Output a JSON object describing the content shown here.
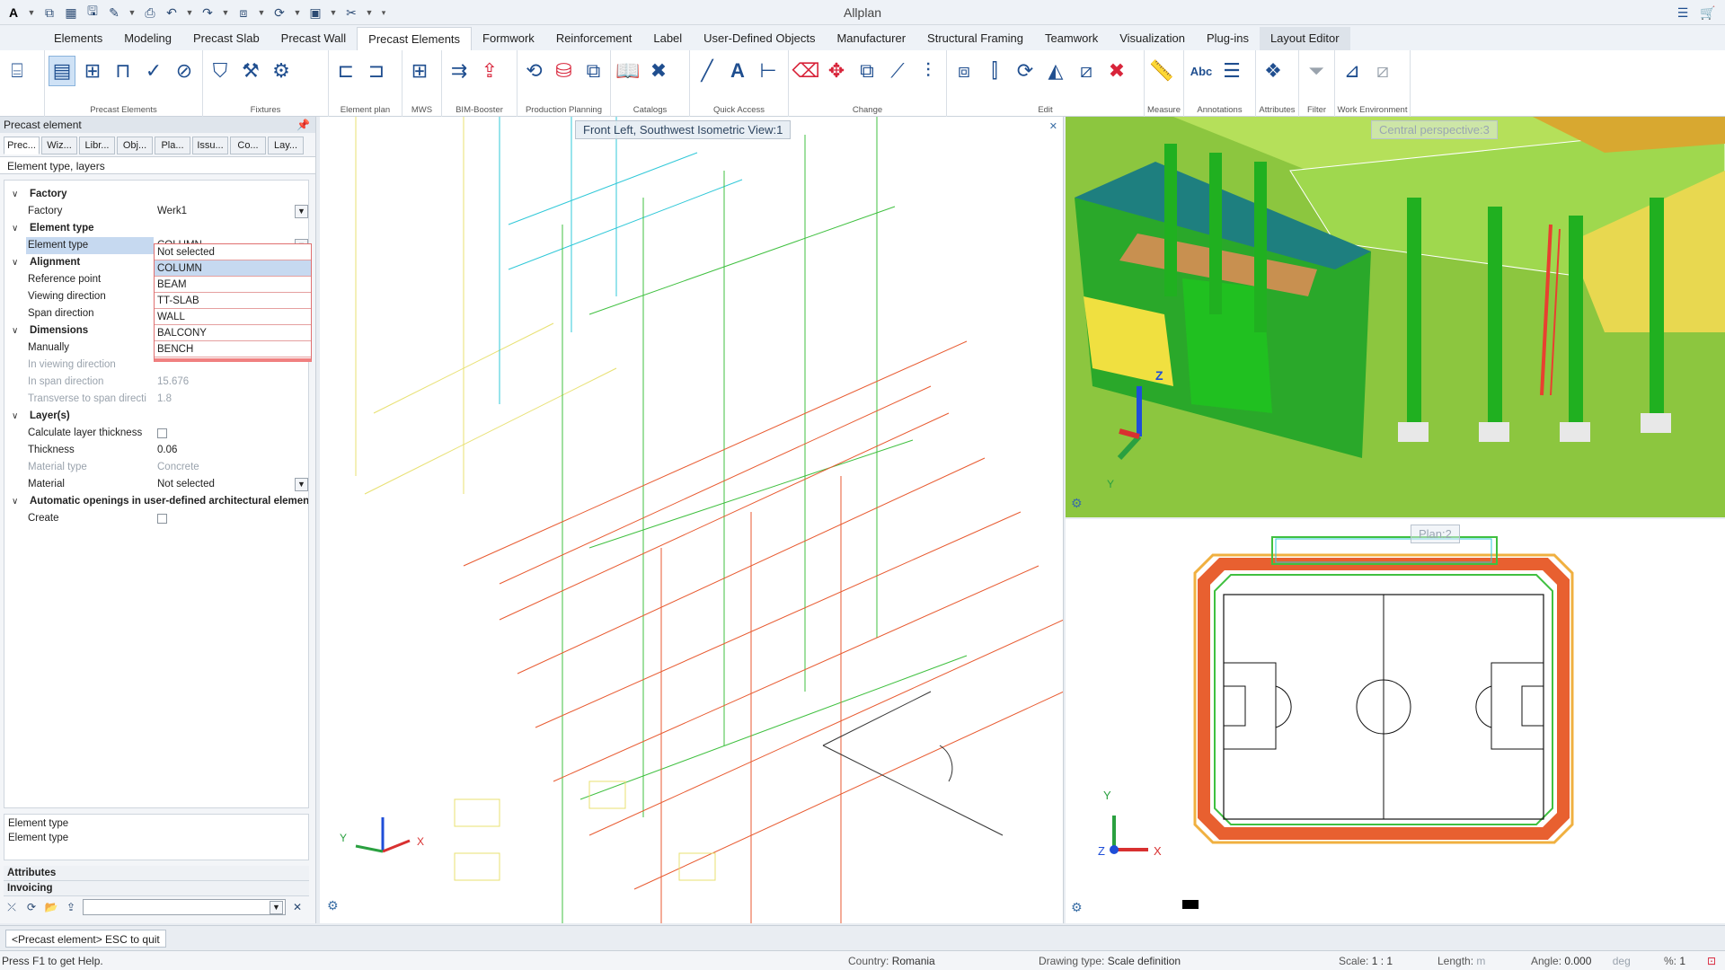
{
  "title_bar": {
    "app_title": "Allplan"
  },
  "ribbon_tabs": [
    {
      "label": "Elements"
    },
    {
      "label": "Modeling"
    },
    {
      "label": "Precast Slab"
    },
    {
      "label": "Precast Wall"
    },
    {
      "label": "Precast Elements"
    },
    {
      "label": "Formwork"
    },
    {
      "label": "Reinforcement"
    },
    {
      "label": "Label"
    },
    {
      "label": "User-Defined Objects"
    },
    {
      "label": "Manufacturer"
    },
    {
      "label": "Structural Framing"
    },
    {
      "label": "Teamwork"
    },
    {
      "label": "Visualization"
    },
    {
      "label": "Plug-ins"
    },
    {
      "label": "Layout Editor"
    }
  ],
  "ribbon_groups": {
    "precast_elements": "Precast Elements",
    "fixtures": "Fixtures",
    "element_plan": "Element plan",
    "mws": "MWS",
    "bim_booster": "BIM-Booster",
    "production_planning": "Production Planning",
    "catalogs": "Catalogs",
    "quick_access": "Quick Access",
    "change": "Change",
    "edit": "Edit",
    "measure": "Measure",
    "annotations": "Annotations",
    "attributes": "Attributes",
    "filter": "Filter",
    "work_environment": "Work Environment"
  },
  "left_panel": {
    "title": "Precast element",
    "tabs": [
      "Prec...",
      "Wiz...",
      "Libr...",
      "Obj...",
      "Pla...",
      "Issu...",
      "Co...",
      "Lay..."
    ],
    "section_title": "Element type, layers",
    "factory_group": "Factory",
    "factory_label": "Factory",
    "factory_value": "Werk1",
    "element_type_group": "Element type",
    "element_type_label": "Element type",
    "element_type_value": "COLUMN",
    "alignment_group": "Alignment",
    "reference_point": "Reference point",
    "viewing_direction": "Viewing direction",
    "span_direction": "Span direction",
    "dimensions_group": "Dimensions",
    "manually": "Manually",
    "in_viewing_direction": "In viewing direction",
    "in_span_direction": "In span direction",
    "in_span_direction_value": "15.676",
    "transverse": "Transverse to span directi",
    "transverse_value": "1.8",
    "layers_group": "Layer(s)",
    "calc_layer_thickness": "Calculate layer thickness",
    "thickness_label": "Thickness",
    "thickness_value": "0.06",
    "material_type_label": "Material type",
    "material_type_value": "Concrete",
    "material_label": "Material",
    "material_value": "Not selected",
    "auto_openings_group": "Automatic openings in user-defined architectural elemen",
    "create_label": "Create",
    "dropdown_options": [
      "Not selected",
      "COLUMN",
      "BEAM",
      "TT-SLAB",
      "WALL",
      "BALCONY",
      "BENCH"
    ],
    "info_title": "Element type",
    "info_text": "Element type",
    "attributes": "Attributes",
    "invoicing": "Invoicing"
  },
  "viewports": {
    "left_label": "Front Left, Southwest Isometric View:1",
    "topright_label": "Central perspective:3",
    "bottomright_label": "Plan:2",
    "axis_x": "X",
    "axis_y": "Y",
    "axis_z": "Z"
  },
  "command_bar": {
    "text": "<Precast element> ESC to quit"
  },
  "status_bar": {
    "help": "Press F1 to get Help.",
    "country_label": "Country:",
    "country_value": "Romania",
    "drawing_type_label": "Drawing type:",
    "drawing_type_value": "Scale definition",
    "scale_label": "Scale:",
    "scale_value": "1 : 1",
    "length_label": "Length:",
    "length_unit": "m",
    "angle_label": "Angle:",
    "angle_value": "0.000",
    "angle_unit": "deg",
    "percent_label": "%:",
    "percent_value": "1"
  }
}
